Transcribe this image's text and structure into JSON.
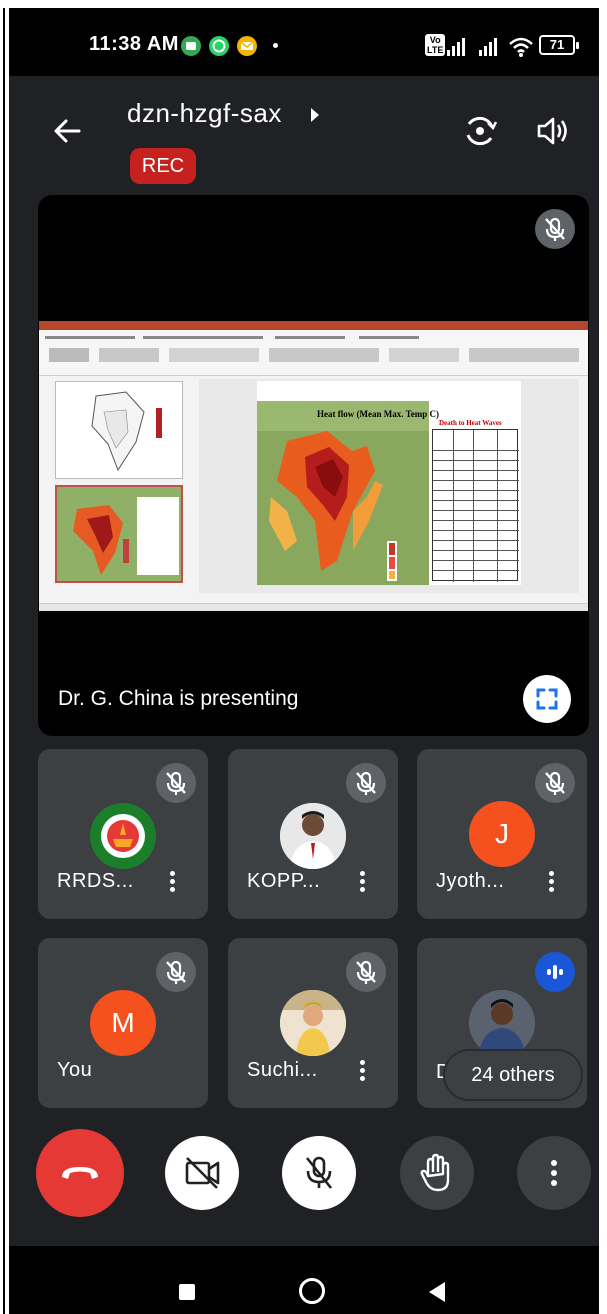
{
  "status_bar": {
    "time": "11:38 AM",
    "notif_icons": [
      "whatsapp-business-icon",
      "whatsapp-icon",
      "email-icon"
    ],
    "volte": "Vo LTE",
    "battery": "71"
  },
  "header": {
    "meeting_code": "dzn-hzgf-sax",
    "rec_label": "REC"
  },
  "stage": {
    "presenter_label": "Dr. G. China is presenting",
    "slide": {
      "heading": "Heat flow (Mean Max. Temp C)",
      "side_heading": "Death to Heat Waves"
    }
  },
  "participants": [
    {
      "name": "RRDS...",
      "avatar": "logo",
      "muted": true
    },
    {
      "name": "KOPP...",
      "avatar": "photo",
      "muted": true
    },
    {
      "name": "Jyoth...",
      "avatar_letter": "J",
      "avatar_color": "#f4511e",
      "muted": true
    },
    {
      "name": "You",
      "avatar_letter": "M",
      "avatar_color": "#f4511e",
      "muted": true
    },
    {
      "name": "Suchi...",
      "avatar": "photo",
      "muted": true
    },
    {
      "name": "Dr.",
      "avatar": "photo",
      "speaking": true
    }
  ],
  "others": "24 others",
  "controls": [
    "end-call",
    "camera-off",
    "mic-off",
    "raise-hand",
    "more-options"
  ],
  "colors": {
    "rec": "#c5221f",
    "end_call": "#e53935",
    "speaking": "#1a57d6",
    "tile": "#3c4043",
    "background": "#202124"
  }
}
